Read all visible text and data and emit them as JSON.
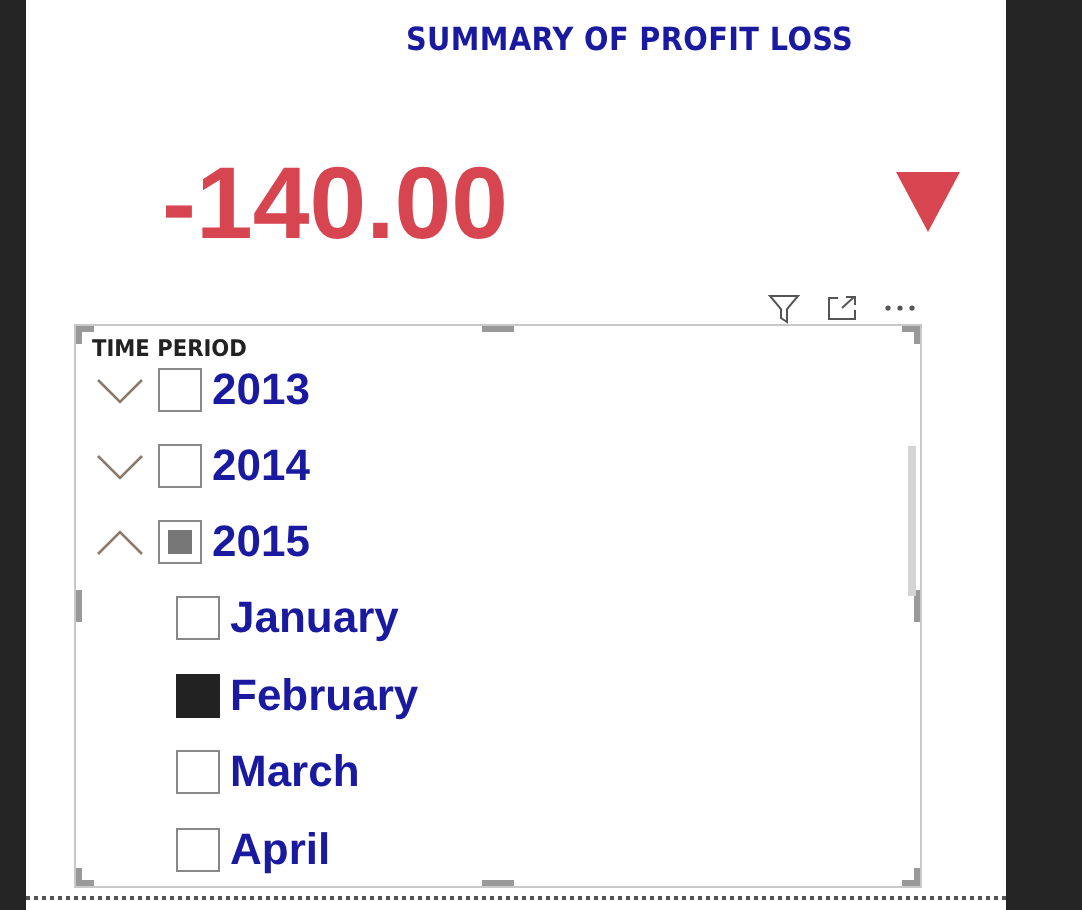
{
  "card": {
    "title": "SUMMARY OF PROFIT LOSS",
    "value": "-140.00"
  },
  "slicer": {
    "title": "TIME PERIOD",
    "items": [
      {
        "label": "2013",
        "expanded": false,
        "checked": false,
        "partial": false
      },
      {
        "label": "2014",
        "expanded": false,
        "checked": false,
        "partial": false
      },
      {
        "label": "2015",
        "expanded": true,
        "checked": false,
        "partial": true,
        "children": [
          {
            "label": "January",
            "checked": false
          },
          {
            "label": "February",
            "checked": true
          },
          {
            "label": "March",
            "checked": false
          },
          {
            "label": "April",
            "checked": false
          }
        ]
      }
    ]
  }
}
